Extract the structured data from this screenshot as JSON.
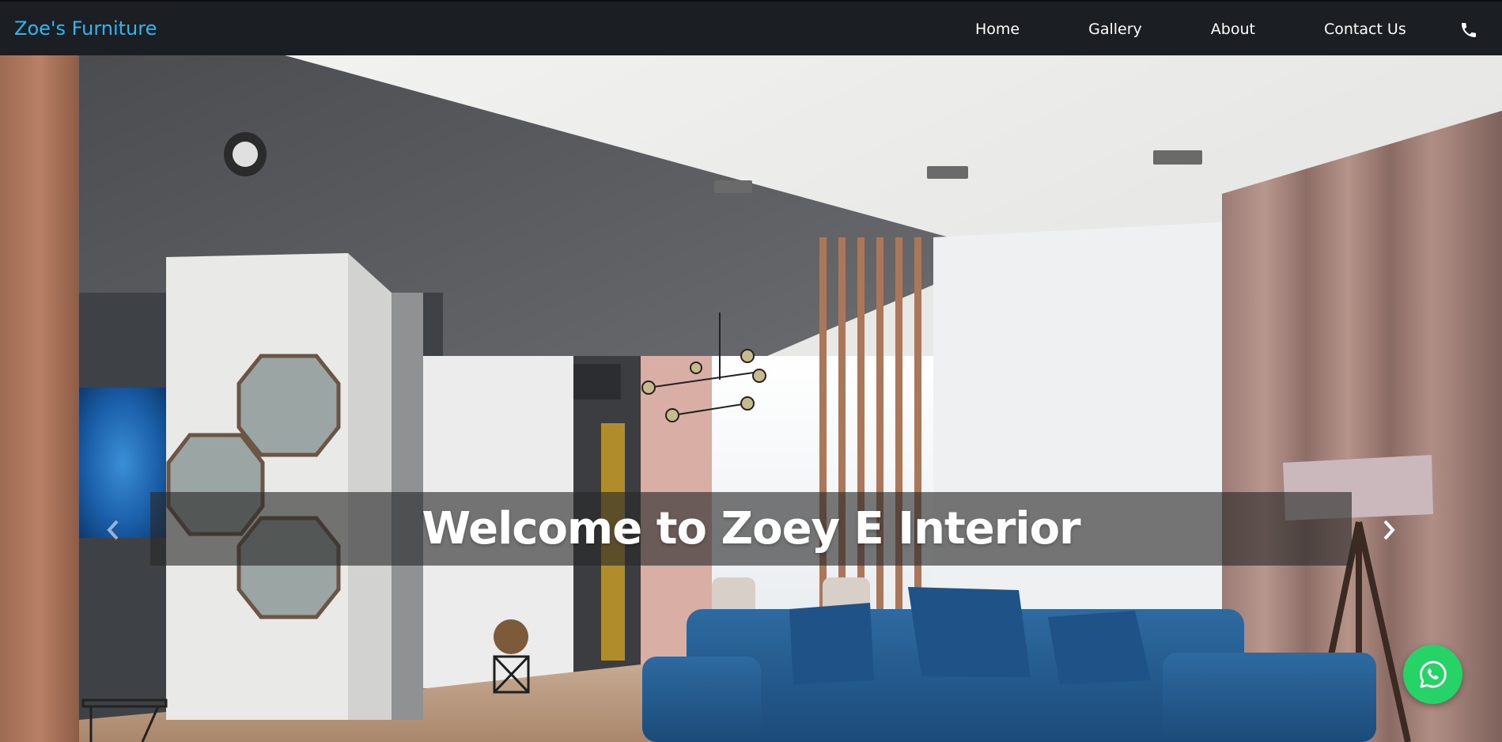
{
  "navbar": {
    "brand": "Zoe's Furniture",
    "links": [
      {
        "label": "Home"
      },
      {
        "label": "Gallery"
      },
      {
        "label": "About"
      },
      {
        "label": "Contact Us"
      }
    ],
    "phone_icon": "phone-icon"
  },
  "hero": {
    "caption": "Welcome to Zoey E Interior",
    "prev_icon": "chevron-left-icon",
    "next_icon": "chevron-right-icon",
    "image": "living-room-interior-photo"
  },
  "floating": {
    "whatsapp_icon": "whatsapp-icon"
  },
  "colors": {
    "navbar_bg": "#1b1f24",
    "brand": "#2fb6f0",
    "whatsapp": "#25d366",
    "caption_band": "rgba(40,40,40,0.62)"
  }
}
